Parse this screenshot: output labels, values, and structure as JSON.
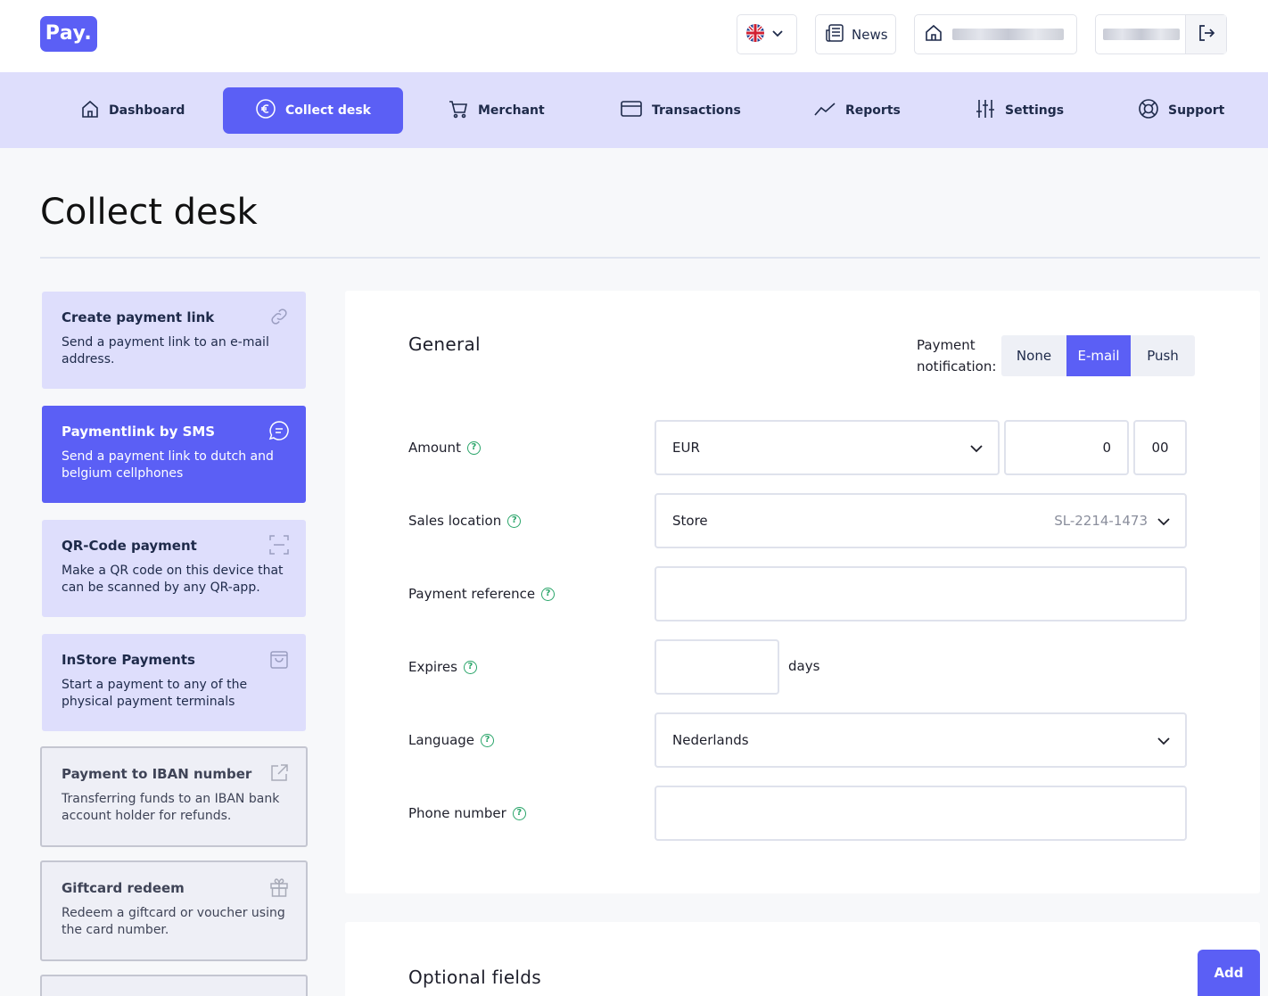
{
  "header": {
    "logo_text": "Pay.",
    "news_label": "News"
  },
  "nav": {
    "items": [
      {
        "label": "Dashboard",
        "icon": "home-icon"
      },
      {
        "label": "Collect desk",
        "icon": "euro-icon"
      },
      {
        "label": "Merchant",
        "icon": "cart-icon"
      },
      {
        "label": "Transactions",
        "icon": "card-icon"
      },
      {
        "label": "Reports",
        "icon": "chart-line-icon"
      },
      {
        "label": "Settings",
        "icon": "sliders-icon"
      },
      {
        "label": "Support",
        "icon": "lifebuoy-icon"
      }
    ],
    "active": "Collect desk"
  },
  "page": {
    "title": "Collect desk"
  },
  "sidebar": {
    "cards": [
      {
        "title": "Create payment link",
        "desc": "Send a payment link to an e-mail address.",
        "icon": "link-icon"
      },
      {
        "title": "Paymentlink by SMS",
        "desc": "Send a payment link to dutch and belgium cellphones",
        "icon": "chat-icon"
      },
      {
        "title": "QR-Code payment",
        "desc": "Make a QR code on this device that can be scanned by any QR-app.",
        "icon": "qr-scan-icon"
      },
      {
        "title": "InStore Payments",
        "desc": "Start a payment to any of the physical payment terminals",
        "icon": "bag-icon"
      },
      {
        "title": "Payment to IBAN number",
        "desc": "Transferring funds to an IBAN bank account holder for refunds.",
        "icon": "external-link-icon"
      },
      {
        "title": "Giftcard redeem",
        "desc": "Redeem a giftcard or voucher using the card number.",
        "icon": "gift-icon"
      }
    ]
  },
  "form": {
    "section_title": "General",
    "notification_label": "Payment notification:",
    "notification_options": [
      "None",
      "E-mail",
      "Push"
    ],
    "notification_selected": "E-mail",
    "amount": {
      "label": "Amount",
      "currency": "EUR",
      "whole": "0",
      "cents": "00"
    },
    "sales_location": {
      "label": "Sales location",
      "value": "Store",
      "code": "SL-2214-1473"
    },
    "payment_reference": {
      "label": "Payment reference",
      "value": ""
    },
    "expires": {
      "label": "Expires",
      "value": "",
      "unit": "days"
    },
    "language": {
      "label": "Language",
      "value": "Nederlands"
    },
    "phone": {
      "label": "Phone number",
      "value": ""
    }
  },
  "optional": {
    "section_title": "Optional fields",
    "add_label": "Add"
  },
  "colors": {
    "accent": "#5b5ff5",
    "nav_bg": "#dedefc",
    "help_green": "#2aa56a"
  }
}
